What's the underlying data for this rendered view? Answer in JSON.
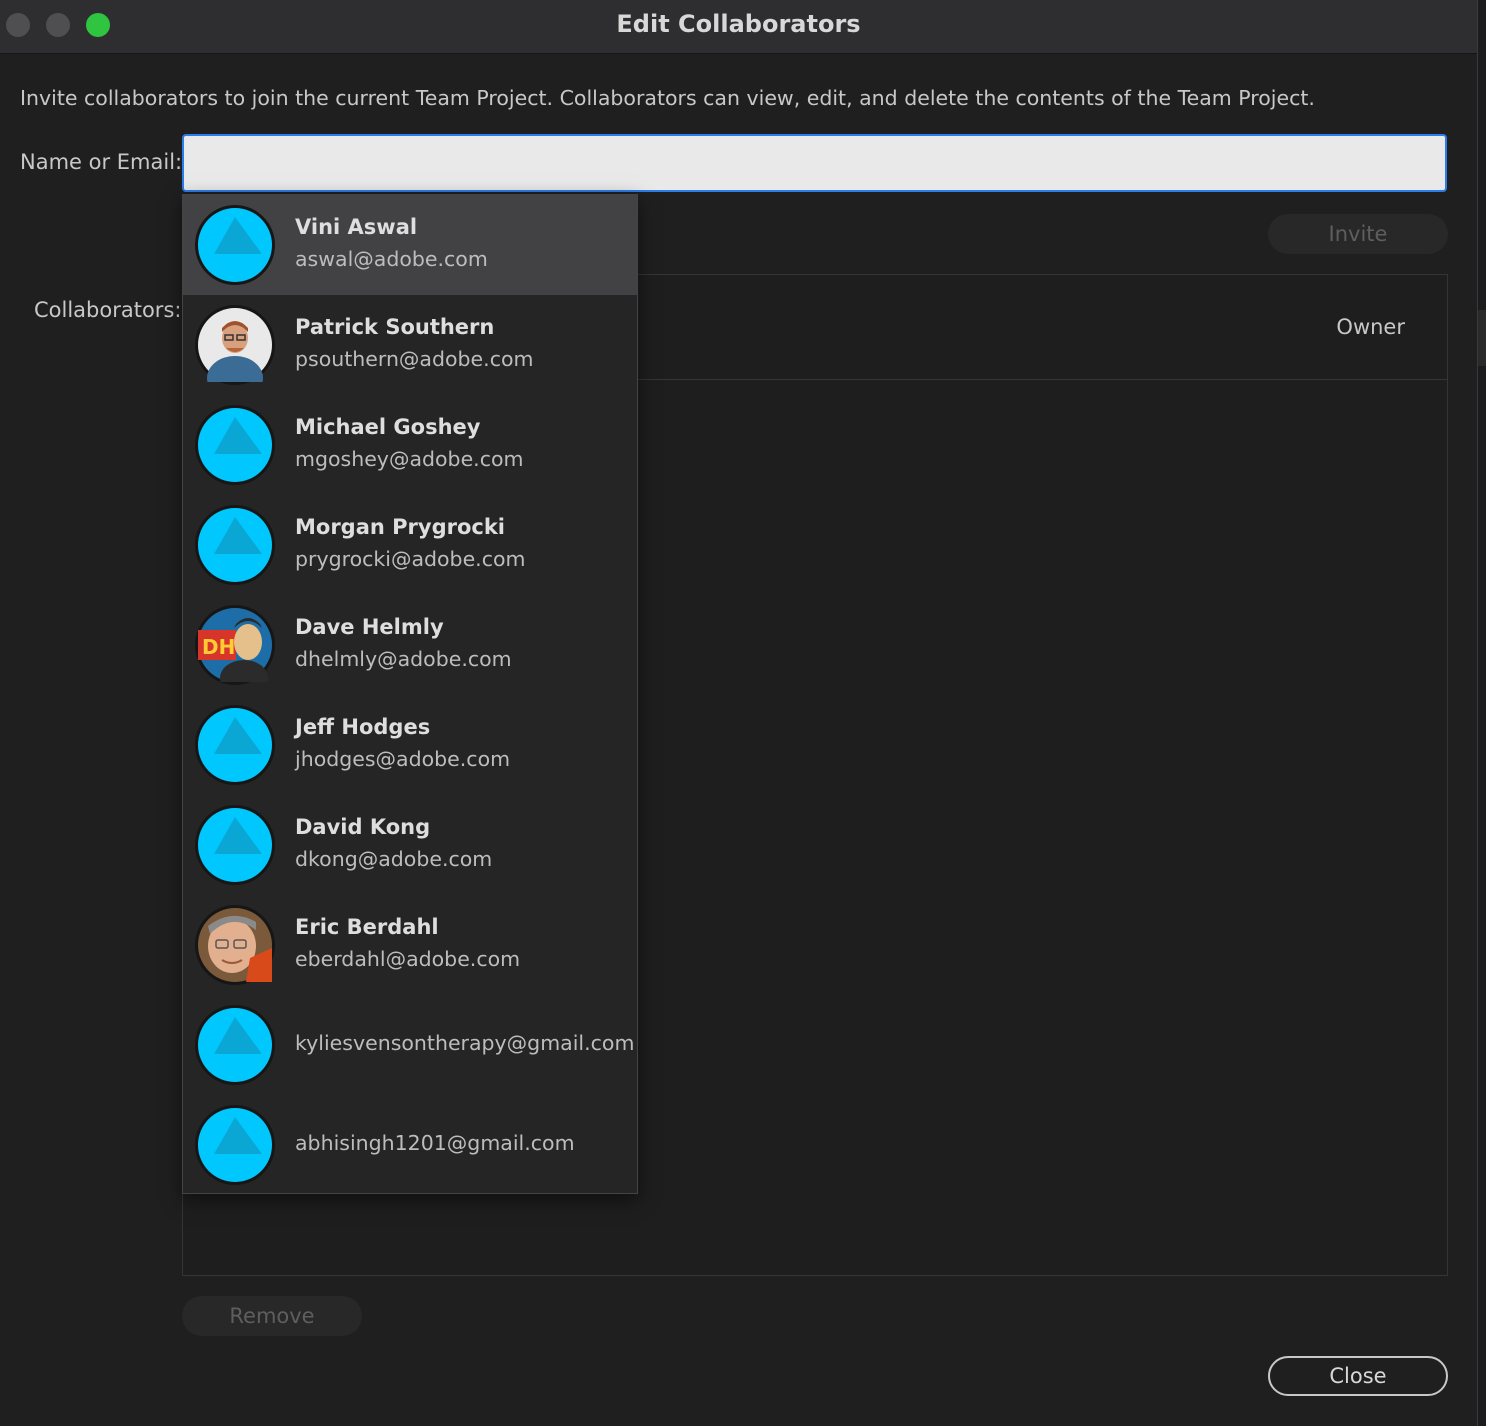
{
  "window": {
    "title": "Edit Collaborators"
  },
  "description": "Invite collaborators to join the current Team Project. Collaborators can view, edit, and delete the contents of the Team Project.",
  "name_field": {
    "label": "Name or Email:",
    "value": "",
    "placeholder": ""
  },
  "invite_label": "Invite",
  "collaborators": {
    "label": "Collaborators:",
    "rows": [
      {
        "name": "",
        "role": "Owner"
      }
    ]
  },
  "remove_label": "Remove",
  "close_label": "Close",
  "colors": {
    "accent": "#2b7de9",
    "avatar_default": "#00c8ff",
    "zoom_button": "#2fc540"
  },
  "suggestions": [
    {
      "name": "Vini Aswal",
      "email": "aswal@adobe.com",
      "avatar": "default-avatar-icon",
      "selected": true
    },
    {
      "name": "Patrick Southern",
      "email": "psouthern@adobe.com",
      "avatar": "user-photo-avatar"
    },
    {
      "name": "Michael Goshey",
      "email": "mgoshey@adobe.com",
      "avatar": "default-avatar-icon"
    },
    {
      "name": "Morgan Prygrocki",
      "email": "prygrocki@adobe.com",
      "avatar": "default-avatar-icon"
    },
    {
      "name": "Dave Helmly",
      "email": "dhelmly@adobe.com",
      "avatar": "user-photo-avatar",
      "avatar_text": "DH"
    },
    {
      "name": "Jeff Hodges",
      "email": "jhodges@adobe.com",
      "avatar": "default-avatar-icon"
    },
    {
      "name": "David Kong",
      "email": "dkong@adobe.com",
      "avatar": "default-avatar-icon"
    },
    {
      "name": "Eric Berdahl",
      "email": "eberdahl@adobe.com",
      "avatar": "user-photo-avatar"
    },
    {
      "name": "",
      "email": "kyliesvensontherapy@gmail.com",
      "avatar": "default-avatar-icon"
    },
    {
      "name": "",
      "email": "abhisingh1201@gmail.com",
      "avatar": "default-avatar-icon"
    }
  ]
}
